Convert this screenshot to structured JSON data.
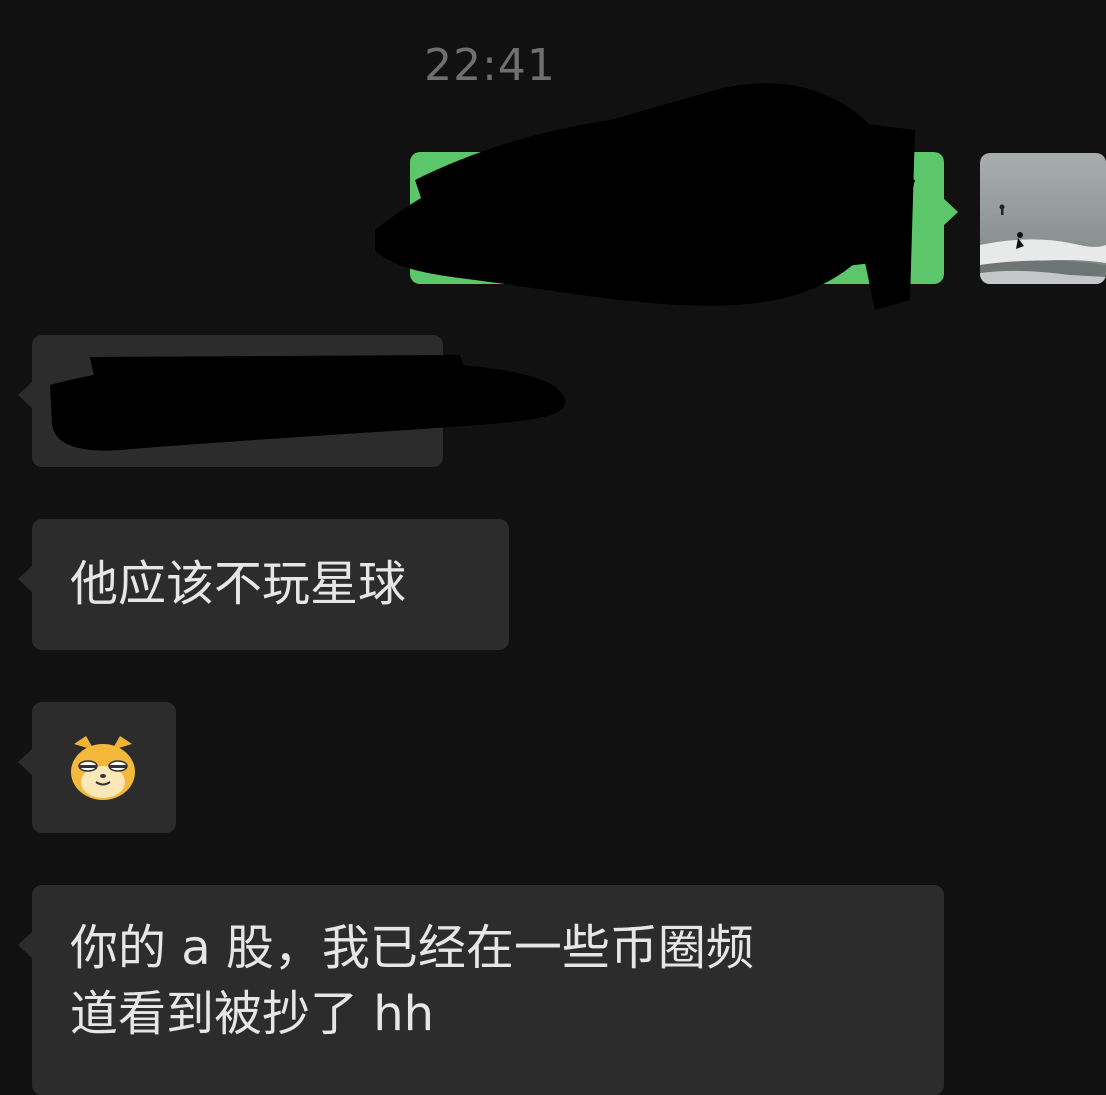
{
  "chat": {
    "timestamp": "22:41",
    "messages": [
      {
        "id": "m1",
        "direction": "outgoing",
        "type": "text",
        "text": "",
        "redacted": true
      },
      {
        "id": "m2",
        "direction": "incoming",
        "type": "text",
        "text": "",
        "redacted": true
      },
      {
        "id": "m3",
        "direction": "incoming",
        "type": "text",
        "text": "他应该不玩星球"
      },
      {
        "id": "m4",
        "direction": "incoming",
        "type": "emoji",
        "emoji": "doge-cat-emoji"
      },
      {
        "id": "m5",
        "direction": "incoming",
        "type": "text",
        "text": "你的 a 股，我已经在一些币圈频\n道看到被抄了 hh"
      }
    ]
  },
  "colors": {
    "background": "#111111",
    "incoming_bubble": "#2c2c2c",
    "outgoing_bubble": "#5cc66b",
    "timestamp_text": "#6f6f6f",
    "message_text": "#e6e6e6"
  }
}
